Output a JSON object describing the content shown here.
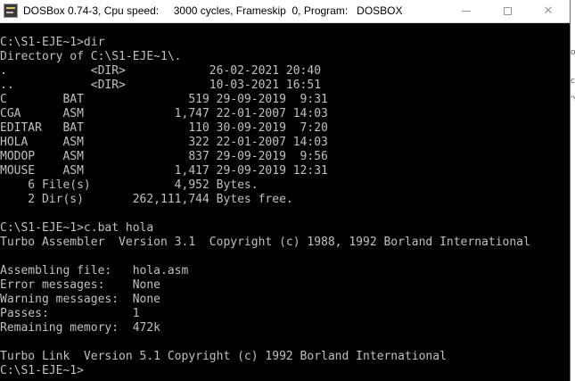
{
  "window": {
    "title": "DOSBox 0.74-3, Cpu speed:     3000 cycles, Frameskip  0, Program:   DOSBOX",
    "icons": {
      "app": "dosbox-app-icon",
      "minimize": "minimize-icon",
      "maximize": "maximize-icon",
      "close": "close-icon"
    }
  },
  "console": {
    "lines": [
      "C:\\S1-EJE~1>dir",
      "Directory of C:\\S1-EJE~1\\.",
      ".            <DIR>            26-02-2021 20:40",
      "..           <DIR>            10-03-2021 16:51",
      "C        BAT               519 29-09-2019  9:31",
      "CGA      ASM             1,747 22-01-2007 14:03",
      "EDITAR   BAT               110 30-09-2019  7:20",
      "HOLA     ASM               322 22-01-2007 14:03",
      "MODOP    ASM               837 29-09-2019  9:56",
      "MOUSE    ASM             1,417 29-09-2019 12:31",
      "    6 File(s)            4,952 Bytes.",
      "    2 Dir(s)       262,111,744 Bytes free.",
      "",
      "C:\\S1-EJE~1>c.bat hola",
      "Turbo Assembler  Version 3.1  Copyright (c) 1988, 1992 Borland International",
      "",
      "Assembling file:   hola.asm",
      "Error messages:    None",
      "Warning messages:  None",
      "Passes:            1",
      "Remaining memory:  472k",
      "",
      "Turbo Link  Version 5.1 Copyright (c) 1992 Borland International",
      "C:\\S1-EJE~1>"
    ]
  },
  "background_fragments": [
    {
      "text": "oc"
    },
    {
      "text": "c"
    },
    {
      "text": "'Y"
    }
  ]
}
